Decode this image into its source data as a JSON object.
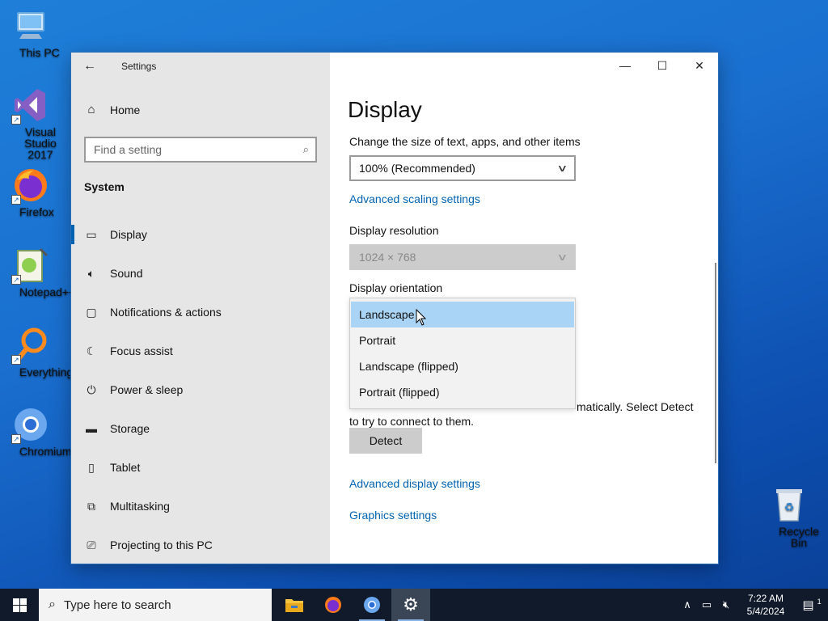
{
  "desktop": {
    "icons": [
      {
        "label": "This PC",
        "icon": "computer-icon"
      },
      {
        "label": "Visual Studio 2017",
        "icon": "visual-studio-icon"
      },
      {
        "label": "Firefox",
        "icon": "firefox-icon"
      },
      {
        "label": "Notepad++",
        "icon": "notepadpp-icon"
      },
      {
        "label": "Everything",
        "icon": "everything-search-icon"
      },
      {
        "label": "Chromium",
        "icon": "chromium-icon"
      }
    ],
    "recycle_bin": {
      "label": "Recycle Bin",
      "icon": "recycle-bin-icon"
    }
  },
  "window": {
    "title": "Settings",
    "controls": {
      "minimize": "—",
      "maximize": "☐",
      "close": "✕"
    }
  },
  "sidebar": {
    "home_label": "Home",
    "search_placeholder": "Find a setting",
    "section_title": "System",
    "items": [
      {
        "label": "Display",
        "icon": "monitor-icon",
        "active": true
      },
      {
        "label": "Sound",
        "icon": "speaker-icon"
      },
      {
        "label": "Notifications & actions",
        "icon": "notification-icon"
      },
      {
        "label": "Focus assist",
        "icon": "moon-icon"
      },
      {
        "label": "Power & sleep",
        "icon": "power-icon"
      },
      {
        "label": "Storage",
        "icon": "storage-icon"
      },
      {
        "label": "Tablet",
        "icon": "tablet-icon"
      },
      {
        "label": "Multitasking",
        "icon": "multitasking-icon"
      },
      {
        "label": "Projecting to this PC",
        "icon": "projector-icon"
      }
    ]
  },
  "content": {
    "page_title": "Display",
    "scale_label": "Change the size of text, apps, and other items",
    "scale_value": "100% (Recommended)",
    "advanced_scaling_link": "Advanced scaling settings",
    "resolution_label": "Display resolution",
    "resolution_value": "1024 × 768",
    "orientation_label": "Display orientation",
    "detect_text_visible": "matically. Select Detect",
    "detect_text_line2": "to try to connect to them.",
    "detect_button": "Detect",
    "advanced_display_link": "Advanced display settings",
    "graphics_link": "Graphics settings"
  },
  "orientation_dropdown": {
    "options": [
      "Landscape",
      "Portrait",
      "Landscape (flipped)",
      "Portrait (flipped)"
    ],
    "selected": "Landscape"
  },
  "taskbar": {
    "search_placeholder": "Type here to search",
    "apps": [
      {
        "name": "File Explorer",
        "icon": "folder-icon"
      },
      {
        "name": "Firefox",
        "icon": "firefox-icon"
      },
      {
        "name": "Chromium",
        "icon": "chromium-icon"
      },
      {
        "name": "Settings",
        "icon": "gear-icon",
        "active": true
      }
    ],
    "time": "7:22 AM",
    "date": "5/4/2024",
    "notification_count": "1"
  }
}
